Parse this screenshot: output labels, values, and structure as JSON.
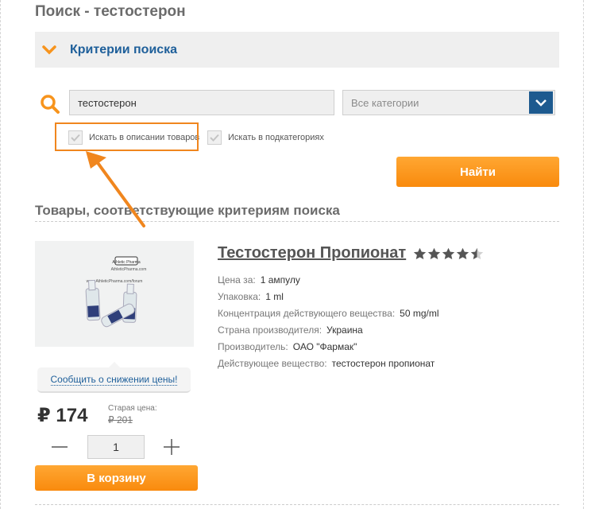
{
  "page": {
    "title": "Поиск - тестостерон"
  },
  "criteria": {
    "label": "Критерии поиска",
    "icon": "chevron-down-icon",
    "accent_color": "#f7941d"
  },
  "search": {
    "value": "тестостерон",
    "category_value": "Все категории",
    "search_in_descriptions_label": "Искать в описании товаров",
    "search_in_subcategories_label": "Искать в подкатегориях",
    "find_button_label": "Найти"
  },
  "results": {
    "title": "Товары, соответствующие критериям поиска",
    "product": {
      "name": "Тестостерон Пропионат",
      "rating": 4.5,
      "image_text": {
        "brand": "Athletic Pharma",
        "site": "AthleticPharma.com",
        "url": "www.AthleticPharma.com/forum"
      },
      "specs": [
        {
          "label": "Цена за:",
          "value": "1 ампулу"
        },
        {
          "label": "Упаковка:",
          "value": "1 ml"
        },
        {
          "label": "Концентрация действующего вещества:",
          "value": "50 mg/ml"
        },
        {
          "label": "Страна производителя:",
          "value": "Украина"
        },
        {
          "label": "Производитель:",
          "value": "ОАО \"Фармак\""
        },
        {
          "label": "Действующее вещество:",
          "value": "тестостерон пропионат"
        }
      ],
      "notify_label": "Сообщить о снижении цены!",
      "price": "₽ 174",
      "old_price_label": "Старая цена:",
      "old_price": "₽ 201",
      "quantity": "1",
      "add_to_cart_label": "В корзину"
    }
  },
  "colors": {
    "orange": "#f98a0d",
    "blue": "#1e5f9a",
    "panel": "#efefef"
  }
}
